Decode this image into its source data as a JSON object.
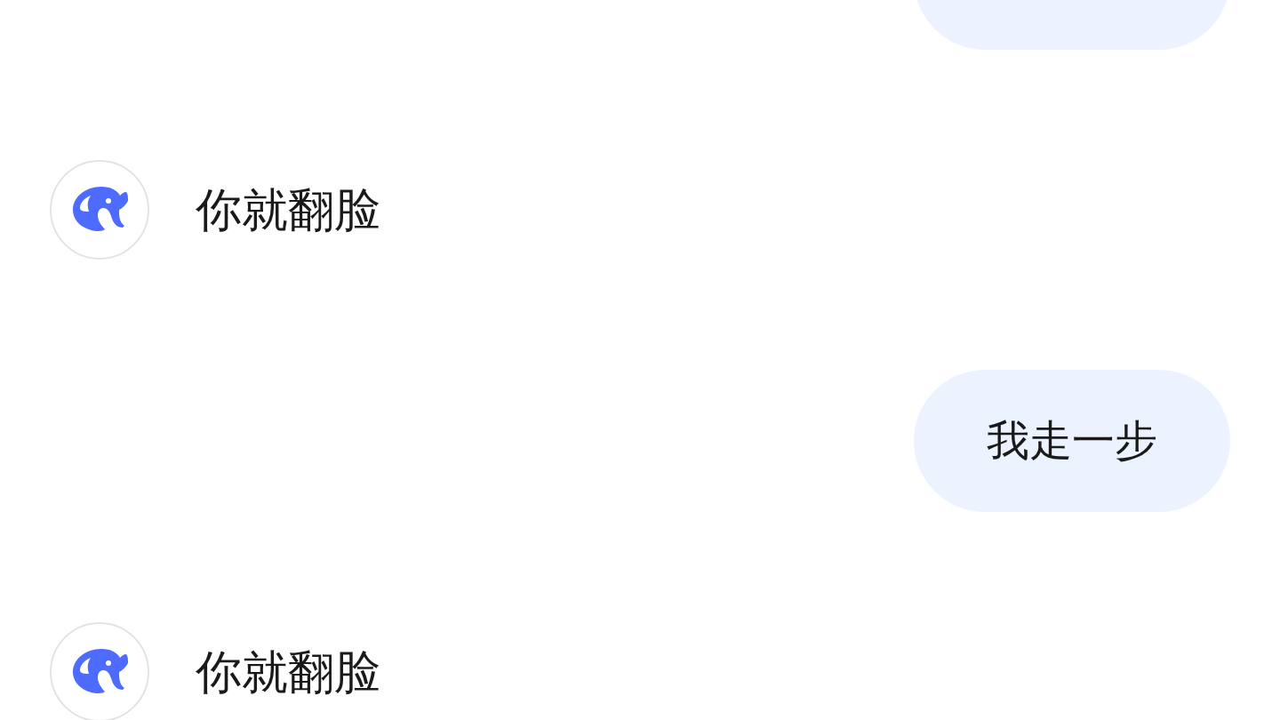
{
  "messages": [
    {
      "kind": "sent"
    },
    {
      "kind": "reply",
      "text": "你就翻脸"
    },
    {
      "kind": "sent",
      "text": "我走一步"
    },
    {
      "kind": "reply",
      "text": "你就翻脸"
    }
  ]
}
